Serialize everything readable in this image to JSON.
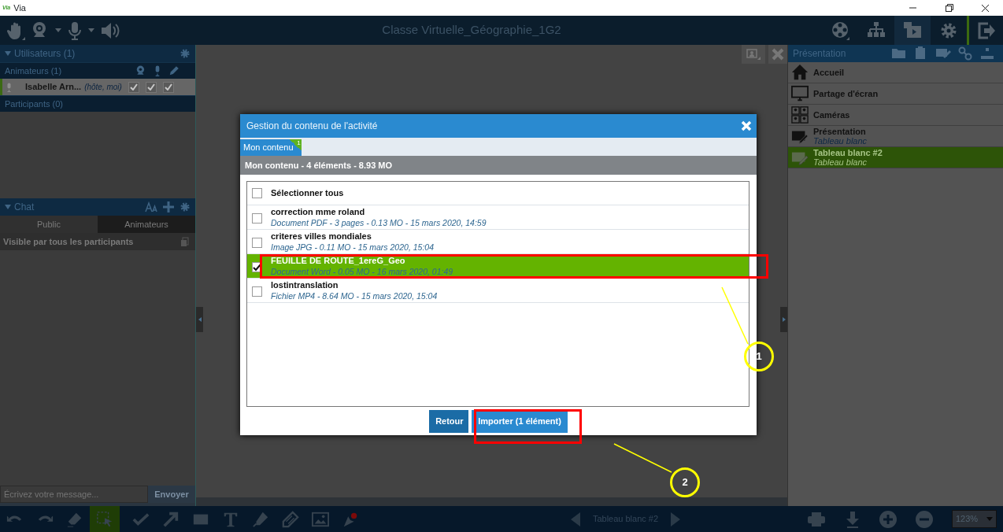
{
  "window": {
    "logo": "Via",
    "title": "Via"
  },
  "top_bar": {
    "title": "Classe Virtuelle_Géographie_1G2",
    "right_tools": [
      {
        "kind": "media",
        "selected": false
      },
      {
        "kind": "layout",
        "selected": false
      },
      {
        "kind": "presentation",
        "selected": true
      },
      {
        "kind": "settings",
        "selected": false
      },
      {
        "kind": "exit",
        "selected": false
      }
    ]
  },
  "users_panel": {
    "title": "Utilisateurs (1)",
    "animators": {
      "title": "Animateurs (1)",
      "members": [
        {
          "name": "Isabelle Arn...",
          "role": "(hôte, moi)",
          "permissions": [
            {
              "checked": true
            },
            {
              "checked": true
            },
            {
              "checked": true
            }
          ]
        }
      ]
    },
    "participants": {
      "title": "Participants (0)"
    }
  },
  "chat": {
    "title": "Chat",
    "tabs": [
      {
        "label": "Public",
        "selected": true
      },
      {
        "label": "Animateurs",
        "selected": false
      }
    ],
    "audience": "Visible par tous les participants",
    "input": {
      "placeholder": "Écrivez votre message..."
    },
    "send_button": "Envoyer"
  },
  "presentation_panel": {
    "title": "Présentation",
    "items": [
      {
        "kind": "home",
        "title": "Accueil",
        "selected": false
      },
      {
        "kind": "screen",
        "title": "Partage d'écran",
        "selected": false
      },
      {
        "kind": "cameras",
        "title": "Caméras",
        "selected": false
      },
      {
        "kind": "board",
        "title": "Présentation",
        "subtitle": "Tableau blanc",
        "selected": false
      },
      {
        "kind": "board",
        "title": "Tableau blanc #2",
        "subtitle": "Tableau blanc",
        "selected": true
      }
    ]
  },
  "bottom_toolbar": {
    "tools": [
      {
        "kind": "undo",
        "selected": false
      },
      {
        "kind": "redo",
        "selected": false
      },
      {
        "kind": "eraser",
        "selected": false
      },
      {
        "kind": "select",
        "selected": true
      },
      {
        "kind": "check",
        "selected": false
      },
      {
        "kind": "arrow",
        "selected": false
      },
      {
        "kind": "rectangle",
        "selected": false
      },
      {
        "kind": "text",
        "selected": false
      },
      {
        "kind": "highlighter",
        "selected": false
      },
      {
        "kind": "pencil",
        "selected": false
      },
      {
        "kind": "image",
        "selected": false
      },
      {
        "kind": "pointer",
        "selected": false
      }
    ],
    "page": "Tableau blanc #2",
    "zoom": "123%"
  },
  "dialog": {
    "title": "Gestion du contenu de l'activité",
    "tabs": [
      {
        "label": "Mon contenu",
        "badge": "1",
        "selected": true
      }
    ],
    "summary": "Mon contenu - 4 éléments - 8.93 MO",
    "select_all": {
      "label": "Sélectionner tous",
      "checked": false
    },
    "files": [
      {
        "name": "correction mme roland",
        "details": "Document PDF - 3 pages - 0.13 MO - 15 mars 2020, 14:59",
        "checked": false,
        "selected": false
      },
      {
        "name": "criteres villes mondiales",
        "details": "Image JPG - 0.11 MO - 15 mars 2020, 15:04",
        "checked": false,
        "selected": false
      },
      {
        "name": "FEUILLE DE ROUTE_1ereG_Geo",
        "details": "Document Word - 0.05 MO - 16 mars 2020, 01:49",
        "checked": true,
        "selected": true
      },
      {
        "name": "lostintranslation",
        "details": "Fichier MP4 - 8.64 MO - 15 mars 2020, 15:04",
        "checked": false,
        "selected": false
      }
    ],
    "buttons": [
      {
        "kind": "back",
        "label": "Retour"
      },
      {
        "kind": "import",
        "label": "Importer (1 élément)"
      }
    ]
  },
  "annotations": [
    {
      "label": "1"
    },
    {
      "label": "2"
    }
  ]
}
